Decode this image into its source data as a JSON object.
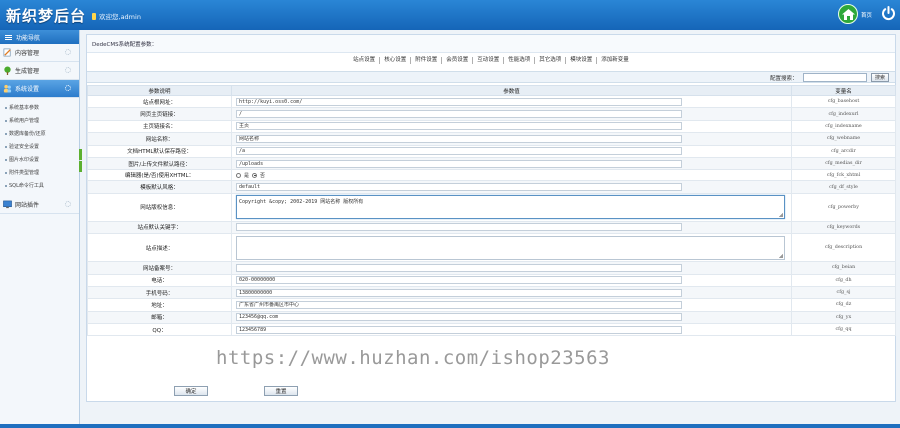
{
  "header": {
    "logo": "新织梦后台",
    "welcome": "欢迎您,admin",
    "home_label": "首页",
    "colors": {
      "bar": "#1f75c7",
      "home": "#2ea83a"
    }
  },
  "sidebar": {
    "title": "功能导航",
    "items": [
      {
        "label": "内容管理",
        "icon": "pencil-icon"
      },
      {
        "label": "生成管理",
        "icon": "tree-icon"
      },
      {
        "label": "系统设置",
        "icon": "people-icon",
        "active": true
      },
      {
        "label": "网站插件",
        "icon": "monitor-icon"
      }
    ],
    "sub_items": [
      "系统基本参数",
      "系统用户管理",
      "数据库备份/还原",
      "验证安全设置",
      "图片水印设置",
      "附件类型管理",
      "SQL命令行工具"
    ]
  },
  "main": {
    "breadcrumb": "DedeCMS系统配置参数：",
    "tabs": [
      "站点设置",
      "核心设置",
      "附件设置",
      "会员设置",
      "互动设置",
      "性能选项",
      "其它选项",
      "模块设置",
      "添加新变量"
    ],
    "search_label": "配置搜索：",
    "search_button": "搜索",
    "table": {
      "headers": [
        "参数说明",
        "参数值",
        "变量名"
      ],
      "rows": [
        {
          "label": "站点根网址：",
          "type": "input",
          "value": "http://kuyi.oss0.com/",
          "key": "cfg_basehost"
        },
        {
          "label": "网页主页链接：",
          "type": "input",
          "value": "/",
          "key": "cfg_indexurl"
        },
        {
          "label": "主页链接名：",
          "type": "input",
          "value": "主页",
          "key": "cfg_indexname"
        },
        {
          "label": "网站名称：",
          "type": "input",
          "value": "网站名称",
          "key": "cfg_webname"
        },
        {
          "label": "文档HTML默认保存路径：",
          "type": "input",
          "value": "/a",
          "key": "cfg_arcdir"
        },
        {
          "label": "图片/上传文件默认路径：",
          "type": "input",
          "value": "/uploads",
          "key": "cfg_medias_dir"
        },
        {
          "label": "编辑器(是/否)使用XHTML：",
          "type": "radio",
          "options": [
            "是",
            "否"
          ],
          "selected": 1,
          "key": "cfg_fck_xhtml"
        },
        {
          "label": "模板默认风格：",
          "type": "input",
          "value": "default",
          "key": "cfg_df_style"
        },
        {
          "label": "网站版权信息：",
          "type": "textarea",
          "value": "Copyright &copy; 2002-2019 网站名称 版权所有",
          "focus": true,
          "key": "cfg_powerby"
        },
        {
          "label": "站点默认关键字：",
          "type": "input",
          "value": "",
          "key": "cfg_keywords"
        },
        {
          "label": "站点描述：",
          "type": "textarea",
          "value": "",
          "key": "cfg_description"
        },
        {
          "label": "网站备案号：",
          "type": "input",
          "value": "",
          "key": "cfg_beian"
        },
        {
          "label": "电话：",
          "type": "input",
          "value": "020-00000000",
          "key": "cfg_dh"
        },
        {
          "label": "手机号码：",
          "type": "input",
          "value": "13800000000",
          "key": "cfg_sj"
        },
        {
          "label": "地址：",
          "type": "input",
          "value": "广东省广州市番禺区市中心",
          "key": "cfg_dz"
        },
        {
          "label": "邮箱：",
          "type": "input",
          "value": "123456@qq.com",
          "key": "cfg_yx"
        },
        {
          "label": "QQ：",
          "type": "input",
          "value": "123456789",
          "key": "cfg_qq"
        }
      ]
    },
    "save_button": "确定",
    "reset_button": "重置"
  },
  "watermark": "https://www.huzhan.com/ishop23563"
}
